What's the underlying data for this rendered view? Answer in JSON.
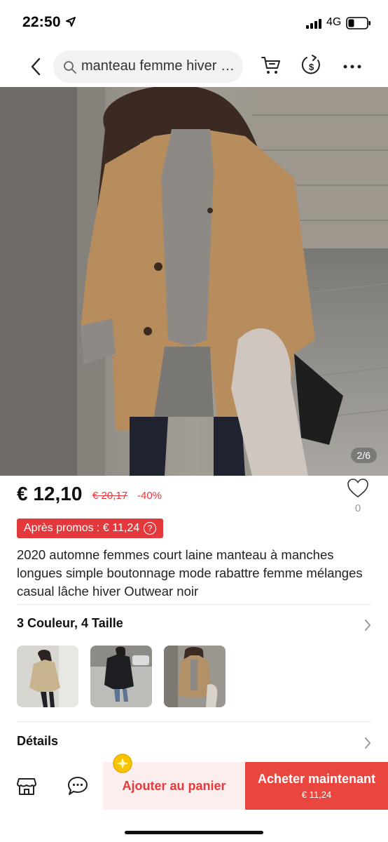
{
  "status_bar": {
    "time": "22:50",
    "network": "4G"
  },
  "nav": {
    "search_text": "manteau femme hiver 2..."
  },
  "product": {
    "image_counter": "2/6",
    "price": "€ 12,10",
    "old_price": "€ 20,17",
    "discount": "-40%",
    "wishlist_count": "0",
    "promo_label": "Après promos : € 11,24",
    "promo_help": "?",
    "title": "2020 automne femmes court laine manteau à manches longues simple boutonnage mode rabattre femme mélanges casual lâche hiver Outwear noir"
  },
  "variants": {
    "label": "3 Couleur, 4 Taille",
    "thumbnails": [
      {
        "color": "#c7b48f"
      },
      {
        "color": "#1e1f22"
      },
      {
        "color": "#b39168"
      }
    ]
  },
  "details": {
    "label": "Détails"
  },
  "bottom_bar": {
    "add_to_cart": "Ajouter au panier",
    "buy_now": "Acheter maintenant",
    "buy_price": "€ 11,24"
  },
  "colors": {
    "accent": "#e4393c",
    "buy_button": "#e9463f",
    "cart_button_bg": "#fdeeee"
  }
}
